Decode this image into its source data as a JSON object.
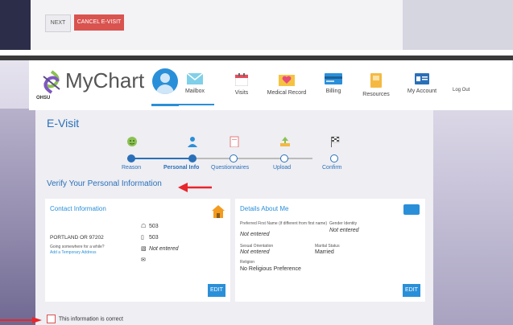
{
  "prev_page": {
    "next_label": "NEXT",
    "cancel_label": "CANCEL E-VISIT"
  },
  "brand": {
    "name": "MyChart",
    "sub": "OHSU"
  },
  "nav": {
    "items": [
      {
        "label": "Mailbox",
        "icon": "envelope-icon"
      },
      {
        "label": "Visits",
        "icon": "calendar-icon"
      },
      {
        "label": "Medical Record",
        "icon": "heart-folder-icon"
      },
      {
        "label": "Billing",
        "icon": "credit-card-icon"
      },
      {
        "label": "Resources",
        "icon": "book-icon"
      },
      {
        "label": "My Account",
        "icon": "id-card-icon"
      }
    ],
    "logout": "Log Out"
  },
  "page": {
    "title": "E-Visit",
    "heading": "Verify Your Personal Information"
  },
  "steps": [
    {
      "label": "Reason",
      "icon": "smiley-icon"
    },
    {
      "label": "Personal Info",
      "icon": "person-icon"
    },
    {
      "label": "Questionnaires",
      "icon": "clipboard-icon"
    },
    {
      "label": "Upload",
      "icon": "upload-icon"
    },
    {
      "label": "Confirm",
      "icon": "checkered-flag-icon"
    }
  ],
  "contact": {
    "title": "Contact Information",
    "address": "PORTLAND OR 97202",
    "going": "Going somewhere for a while?",
    "add_temp": "Add a Temporary Address",
    "home_phone": "503",
    "mobile_phone": "503",
    "work_phone": "Not entered",
    "edit": "EDIT"
  },
  "details": {
    "title": "Details About Me",
    "pref_name_label": "Preferred First Name (if different from first name)",
    "pref_name_value": "Not entered",
    "gender_label": "Gender Identity",
    "gender_value": "Not entered",
    "orientation_label": "Sexual Orientation",
    "orientation_value": "Not entered",
    "marital_label": "Marital Status",
    "marital_value": "Married",
    "religion_label": "Religion",
    "religion_value": "No Religious Preference",
    "edit": "EDIT"
  },
  "confirm": {
    "label": "This information is correct",
    "checked": false
  },
  "colors": {
    "accent": "#2a8fd9",
    "title_blue": "#2a70b8",
    "danger": "#d9534f",
    "annotation_arrow": "#e8262c"
  }
}
